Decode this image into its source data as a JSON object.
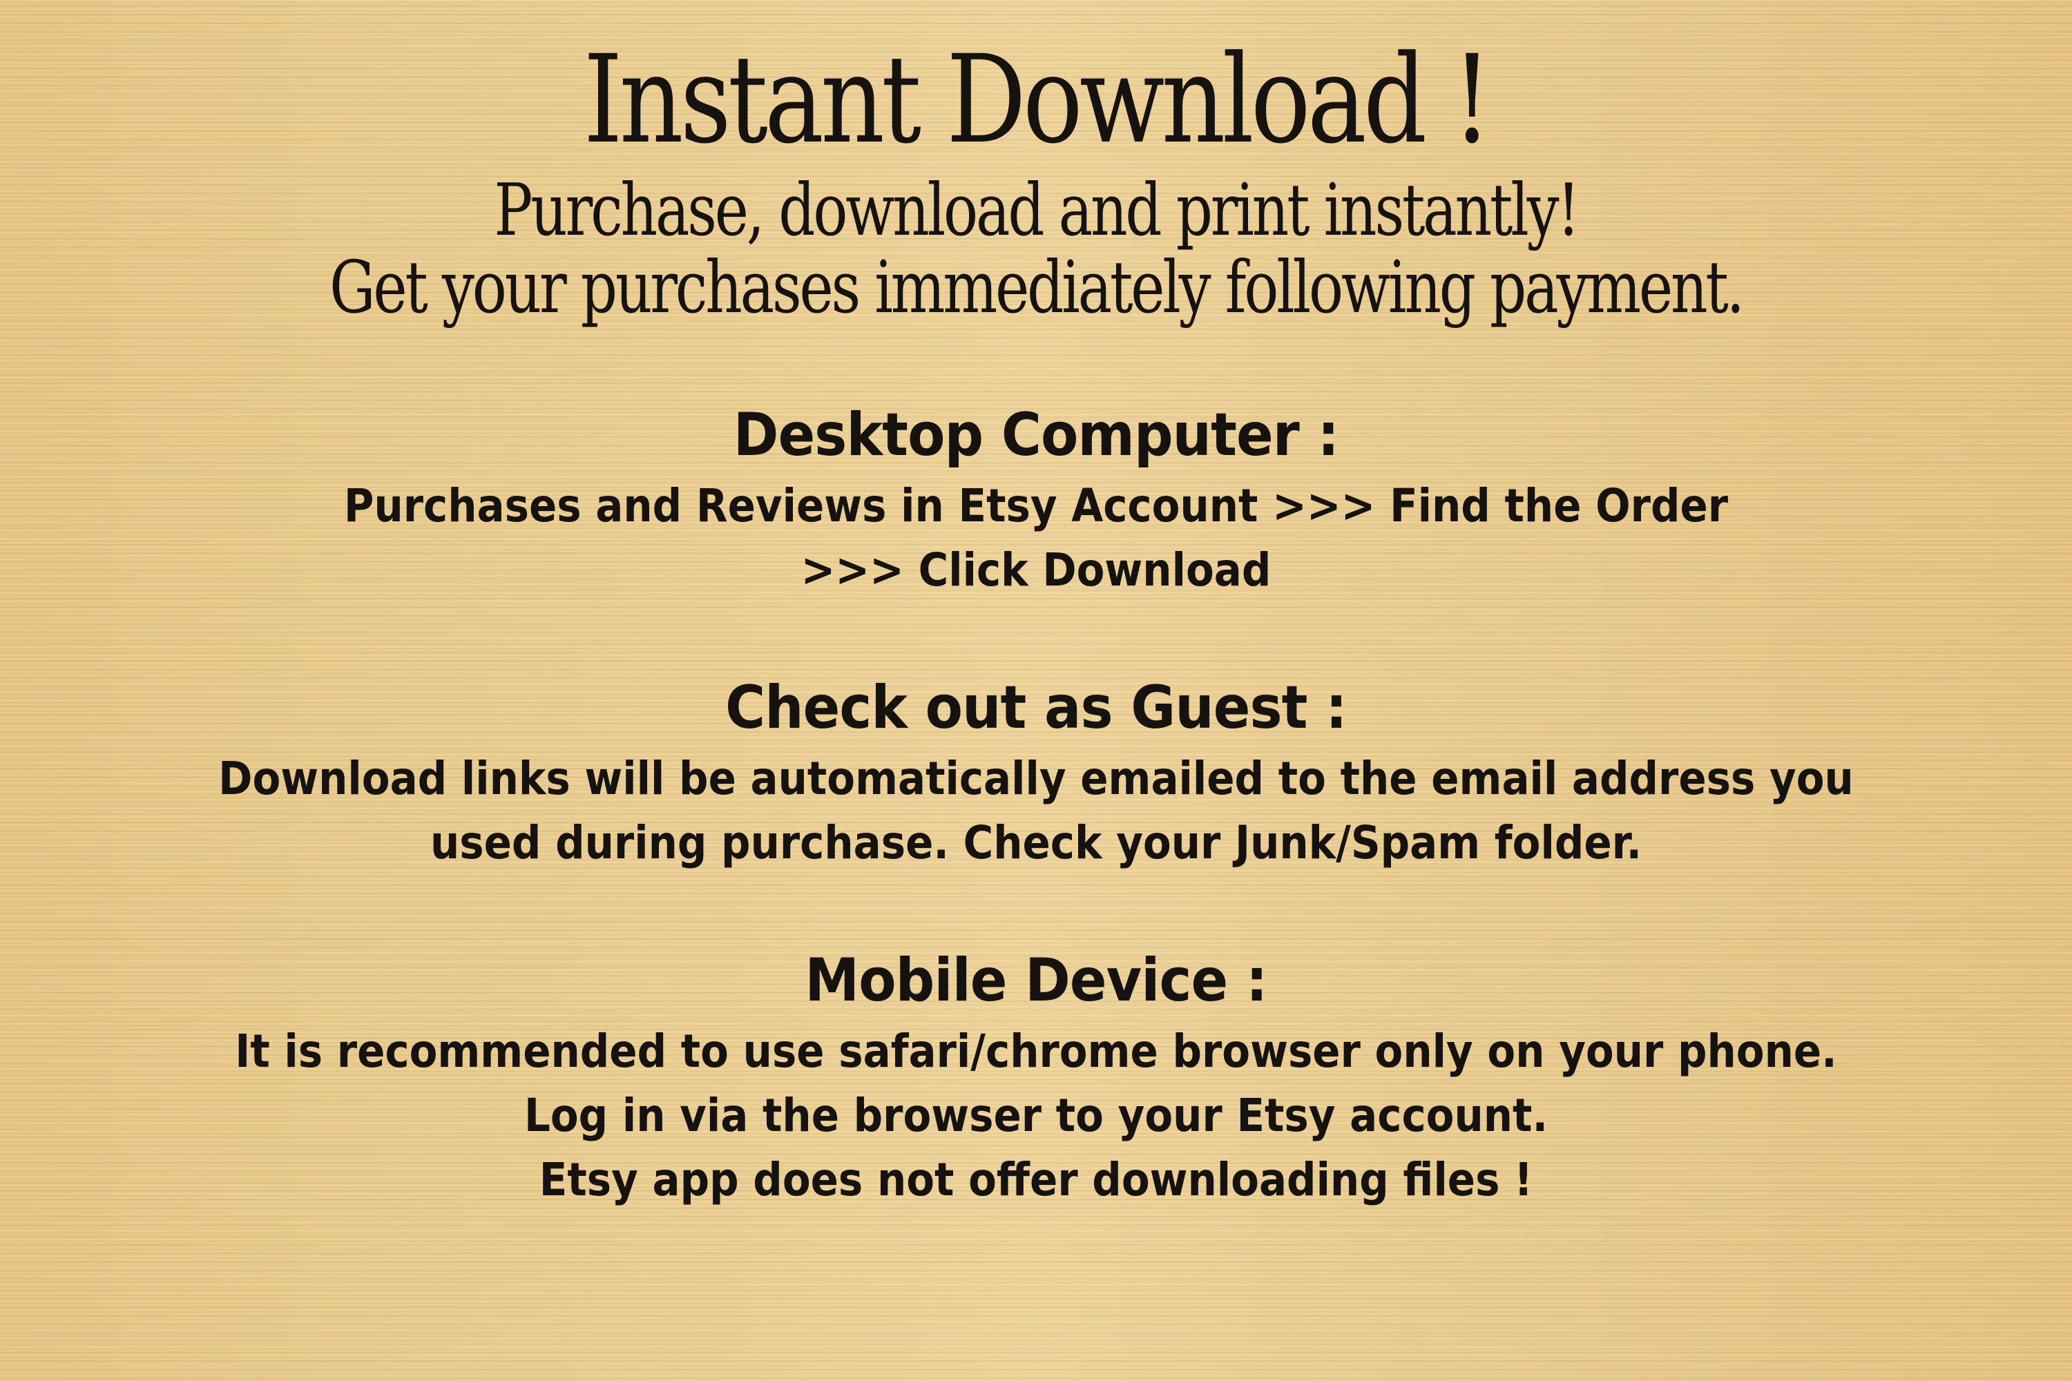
{
  "header": {
    "title": "Instant Download !",
    "subtitle_line1": "Purchase, download and print instantly!",
    "subtitle_line2": "Get your purchases immediately following payment."
  },
  "sections": [
    {
      "heading": "Desktop Computer :",
      "lines": [
        "Purchases and Reviews in Etsy Account >>> Find the Order",
        ">>> Click Download"
      ]
    },
    {
      "heading": "Check out as Guest :",
      "lines": [
        "Download links will be automatically emailed to the email address you",
        "used during purchase. Check your Junk/Spam folder."
      ]
    },
    {
      "heading": "Mobile Device :",
      "lines": [
        "It is recommended to use safari/chrome browser only on your phone.",
        "Log in via the browser to your Etsy account.",
        "Etsy app does not offer downloading files !"
      ]
    }
  ]
}
